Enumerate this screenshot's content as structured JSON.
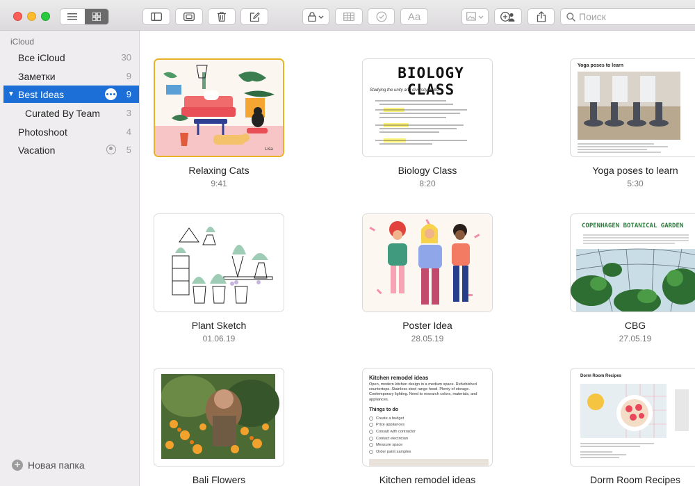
{
  "window": {
    "search": {
      "placeholder": "Поиск"
    },
    "colors": {
      "accent": "#1d6fd8",
      "selection_border": "#e9b226"
    }
  },
  "sidebar": {
    "section": "iCloud",
    "items": [
      {
        "label": "Все iCloud",
        "count": "30"
      },
      {
        "label": "Заметки",
        "count": "9"
      },
      {
        "label": "Best Ideas",
        "count": "9",
        "selected": true
      },
      {
        "label": "Curated By Team",
        "count": "3"
      },
      {
        "label": "Photoshoot",
        "count": "4"
      },
      {
        "label": "Vacation",
        "count": "5",
        "shared": true
      }
    ],
    "new_folder": "Новая папка"
  },
  "toolbar": {
    "icons": [
      "list-view-icon",
      "gallery-view-icon",
      "sidebar-icon",
      "attachments-icon",
      "trash-icon",
      "compose-icon",
      "lock-icon",
      "table-icon",
      "checklist-icon",
      "format-icon",
      "media-icon",
      "collaborate-icon",
      "share-icon",
      "search-icon"
    ],
    "format_glyph": "Aa"
  },
  "notes": [
    {
      "title": "Relaxing Cats",
      "date": "9:41"
    },
    {
      "title": "Biology Class",
      "date": "8:20"
    },
    {
      "title": "Yoga poses to learn",
      "date": "5:30"
    },
    {
      "title": "Plant Sketch",
      "date": "01.06.19"
    },
    {
      "title": "Poster Idea",
      "date": "28.05.19"
    },
    {
      "title": "CBG",
      "date": "27.05.19"
    },
    {
      "title": "Bali Flowers",
      "date": ""
    },
    {
      "title": "Kitchen remodel ideas",
      "date": ""
    },
    {
      "title": "Dorm Room Recipes",
      "date": ""
    }
  ],
  "thumbs": {
    "biology": {
      "heading": "BIOLOGY CLASS",
      "sub": "Studying the unity and diversity of life."
    },
    "yoga": {
      "heading": "Yoga poses to learn"
    },
    "cbg": {
      "heading": "COPENHAGEN BOTANICAL GARDEN"
    },
    "kitchen": {
      "heading": "Kitchen remodel ideas",
      "body": "Open, modern kitchen design in a medium space. Refurbished countertops. Stainless steel range hood. Plenty of storage. Contemporary lighting. Need to research colors, materials, and appliances.",
      "todo_heading": "Things to do",
      "todos": [
        "Create a budget",
        "Price appliances",
        "Consult with contractor",
        "Contact electrician",
        "Measure space",
        "Order paint samples"
      ]
    },
    "dorm": {
      "heading": "Dorm Room Recipes"
    }
  }
}
